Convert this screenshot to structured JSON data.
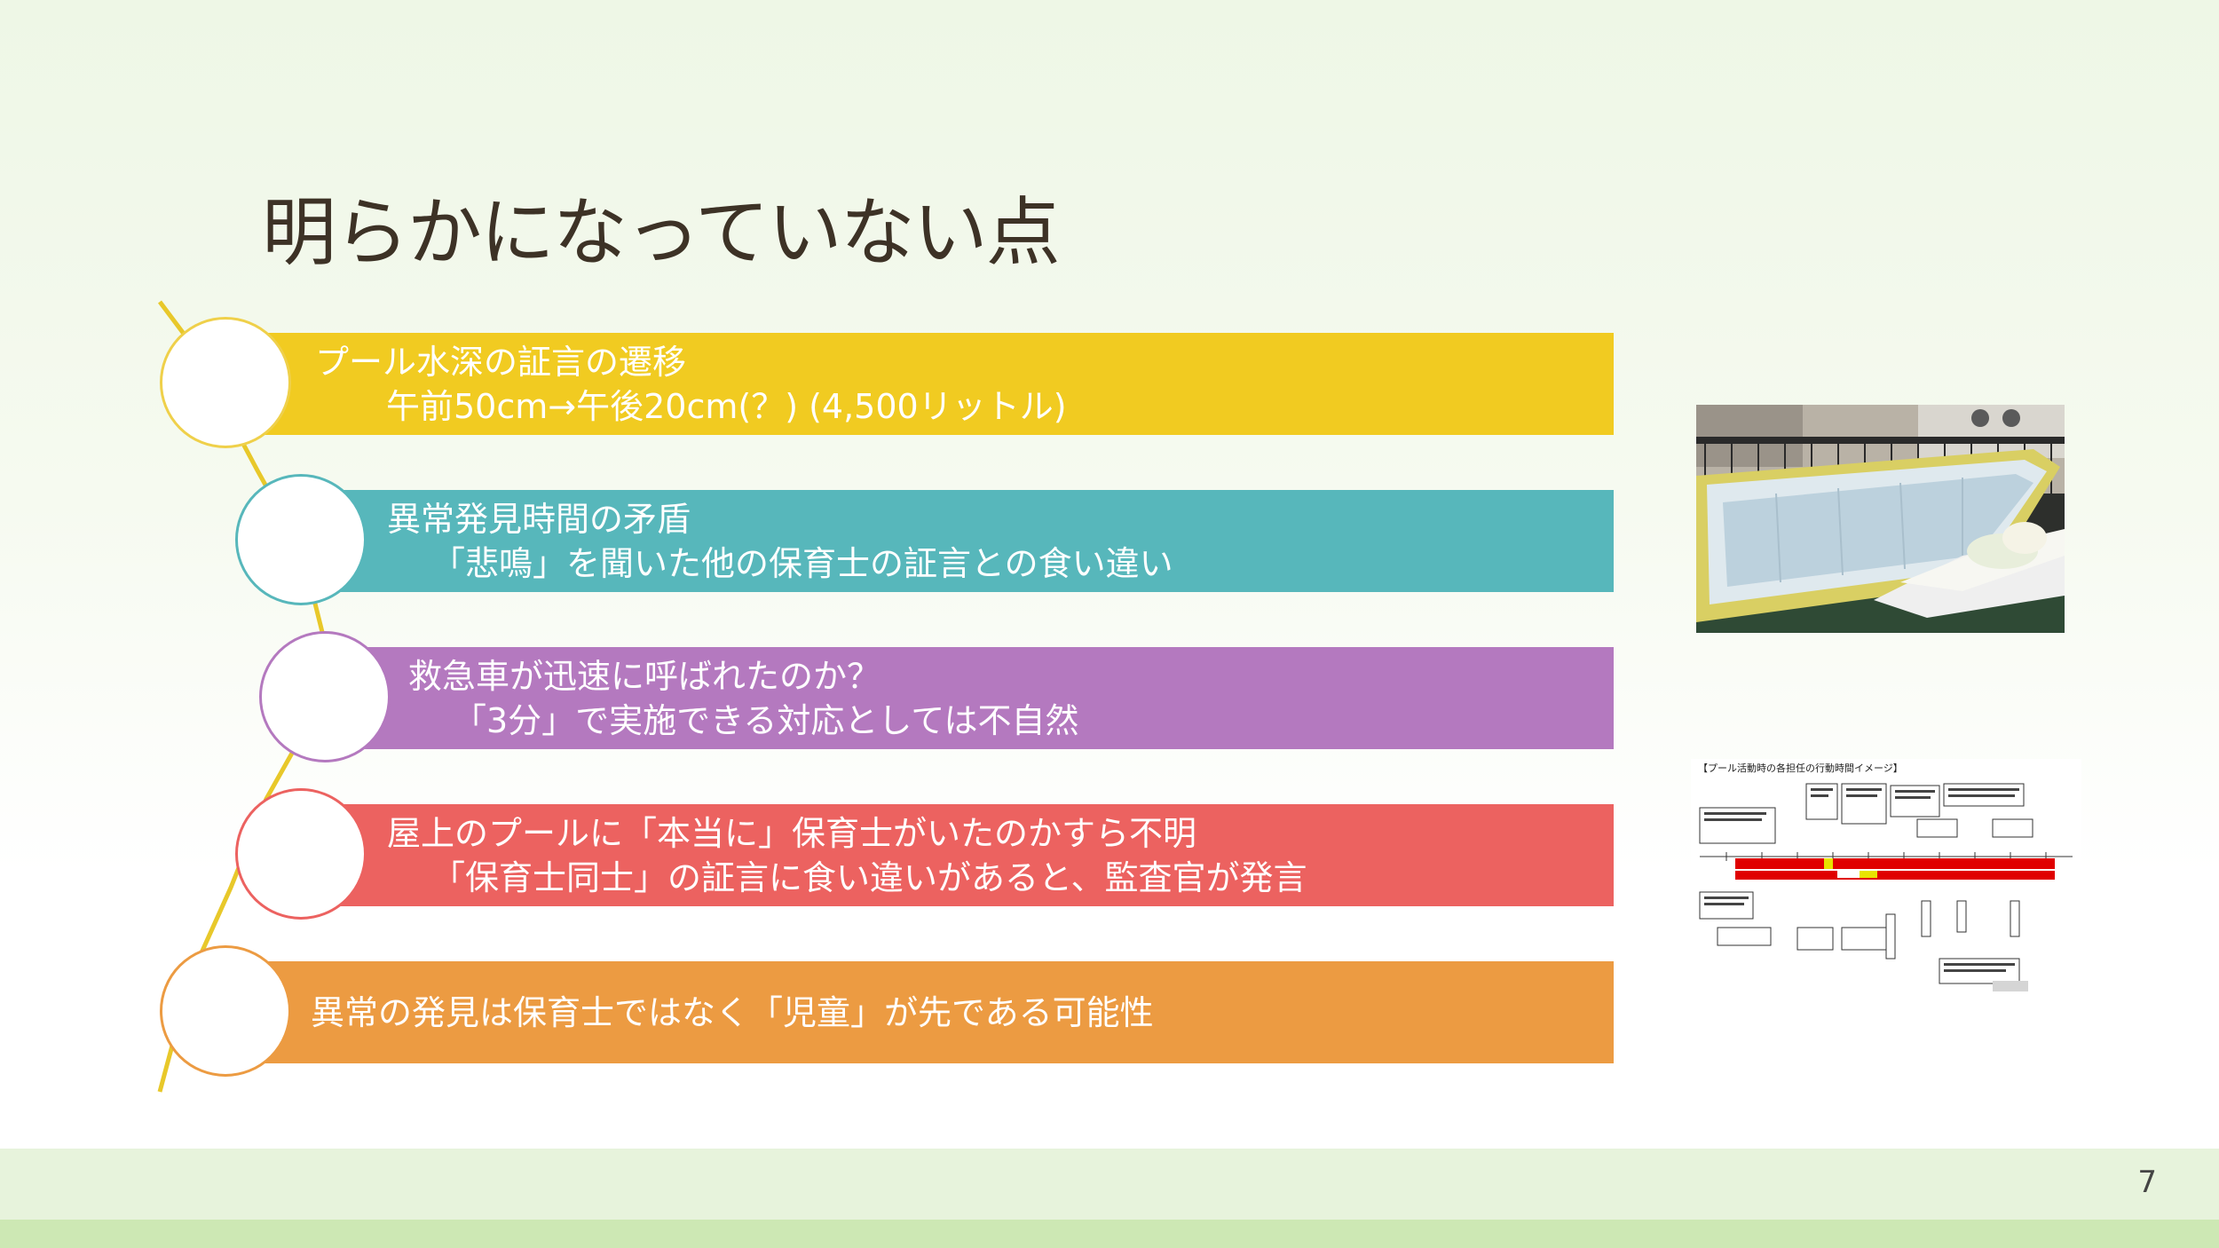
{
  "slide": {
    "title": "明らかになっていない点",
    "page_number": "7"
  },
  "items": [
    {
      "line1": "プール水深の証言の遷移",
      "line2": "午前50cm→午後20cm(？) (4,500リットル)",
      "color": "#f1cb21"
    },
    {
      "line1": "異常発見時間の矛盾",
      "line2": "「悲鳴」を聞いた他の保育士の証言との食い違い",
      "color": "#57b7bb"
    },
    {
      "line1": "救急車が迅速に呼ばれたのか？",
      "line2": "「3分」で実施できる対応としては不自然",
      "color": "#b479bf"
    },
    {
      "line1": "屋上のプールに「本当に」保育士がいたのかすら不明",
      "line2": "「保育士同士」の証言に食い違いがあると、監査官が発言",
      "color": "#ec6260"
    },
    {
      "line1": "異常の発見は保育士ではなく「児童」が先である可能性",
      "color": "#ec9b42"
    }
  ],
  "diagram": {
    "title": "【プール活動時の各担任の行動時間イメージ】"
  }
}
